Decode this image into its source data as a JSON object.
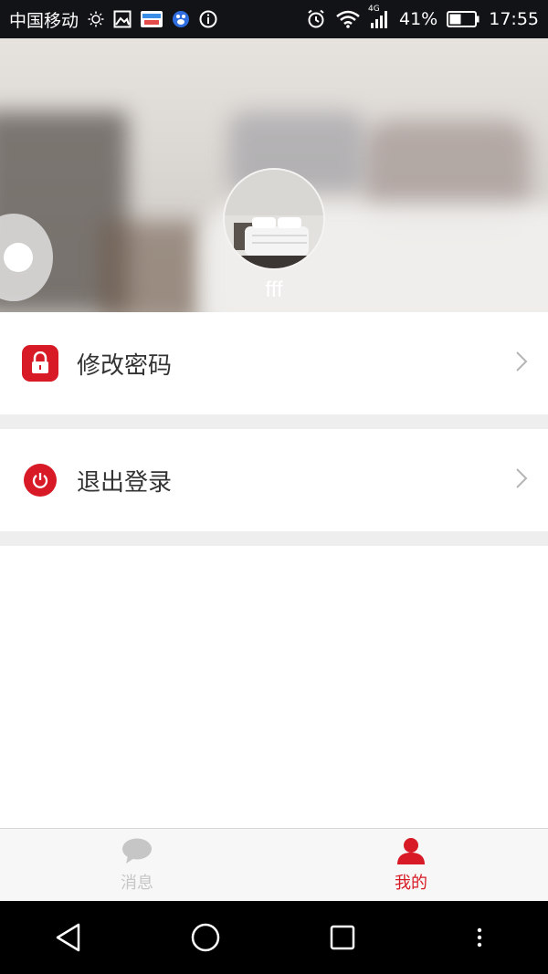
{
  "status_bar": {
    "carrier": "中国移动",
    "network_type": "4G",
    "battery": "41%",
    "time": "17:55",
    "icons": [
      "brightness-icon",
      "gallery-icon",
      "youku-icon",
      "baidu-icon",
      "info-icon",
      "alarm-icon",
      "wifi-icon",
      "signal-icon",
      "battery-icon"
    ]
  },
  "profile": {
    "username": "fff",
    "avatar": "avatar-bedroom-photo"
  },
  "menu": {
    "items": [
      {
        "label": "修改密码",
        "icon": "lock-icon"
      },
      {
        "label": "退出登录",
        "icon": "power-icon"
      }
    ]
  },
  "tabbar": {
    "tabs": [
      {
        "label": "消息",
        "icon": "message-bubble-icon",
        "active": false
      },
      {
        "label": "我的",
        "icon": "person-icon",
        "active": true
      }
    ]
  },
  "navbar": {
    "buttons": [
      "back-icon",
      "home-icon",
      "recent-apps-icon",
      "menu-dots-icon"
    ]
  },
  "colors": {
    "accent": "#d71a25",
    "status_bar_bg": "#121316",
    "separator": "#eeeeee",
    "tab_inactive": "#c6c6c6"
  }
}
